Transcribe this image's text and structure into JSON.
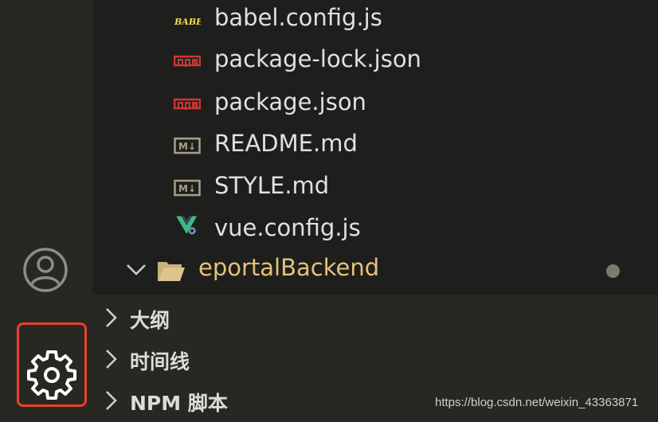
{
  "explorer": {
    "files": [
      {
        "name": "babel.config.js",
        "icon": "babel-icon",
        "icon_text": "BABEL"
      },
      {
        "name": "package-lock.json",
        "icon": "npm-icon",
        "icon_text": "npm"
      },
      {
        "name": "package.json",
        "icon": "npm-icon",
        "icon_text": "npm"
      },
      {
        "name": "README.md",
        "icon": "markdown-icon",
        "icon_text": "M↓"
      },
      {
        "name": "STYLE.md",
        "icon": "markdown-icon",
        "icon_text": "M↓"
      },
      {
        "name": "vue.config.js",
        "icon": "vue-config-icon"
      }
    ],
    "folder": {
      "name": "eportalBackend",
      "expanded": true,
      "modified": true
    }
  },
  "sections": [
    {
      "label": "大纲",
      "expanded": false
    },
    {
      "label": "时间线",
      "expanded": false
    },
    {
      "label": "NPM 脚本",
      "expanded": false
    }
  ],
  "colors": {
    "background": "#272822",
    "explorer_bg": "#1e1f1c",
    "folder_text": "#e6c07b",
    "highlight_border": "#e8402f"
  },
  "watermark": "https://blog.csdn.net/weixin_43363871"
}
